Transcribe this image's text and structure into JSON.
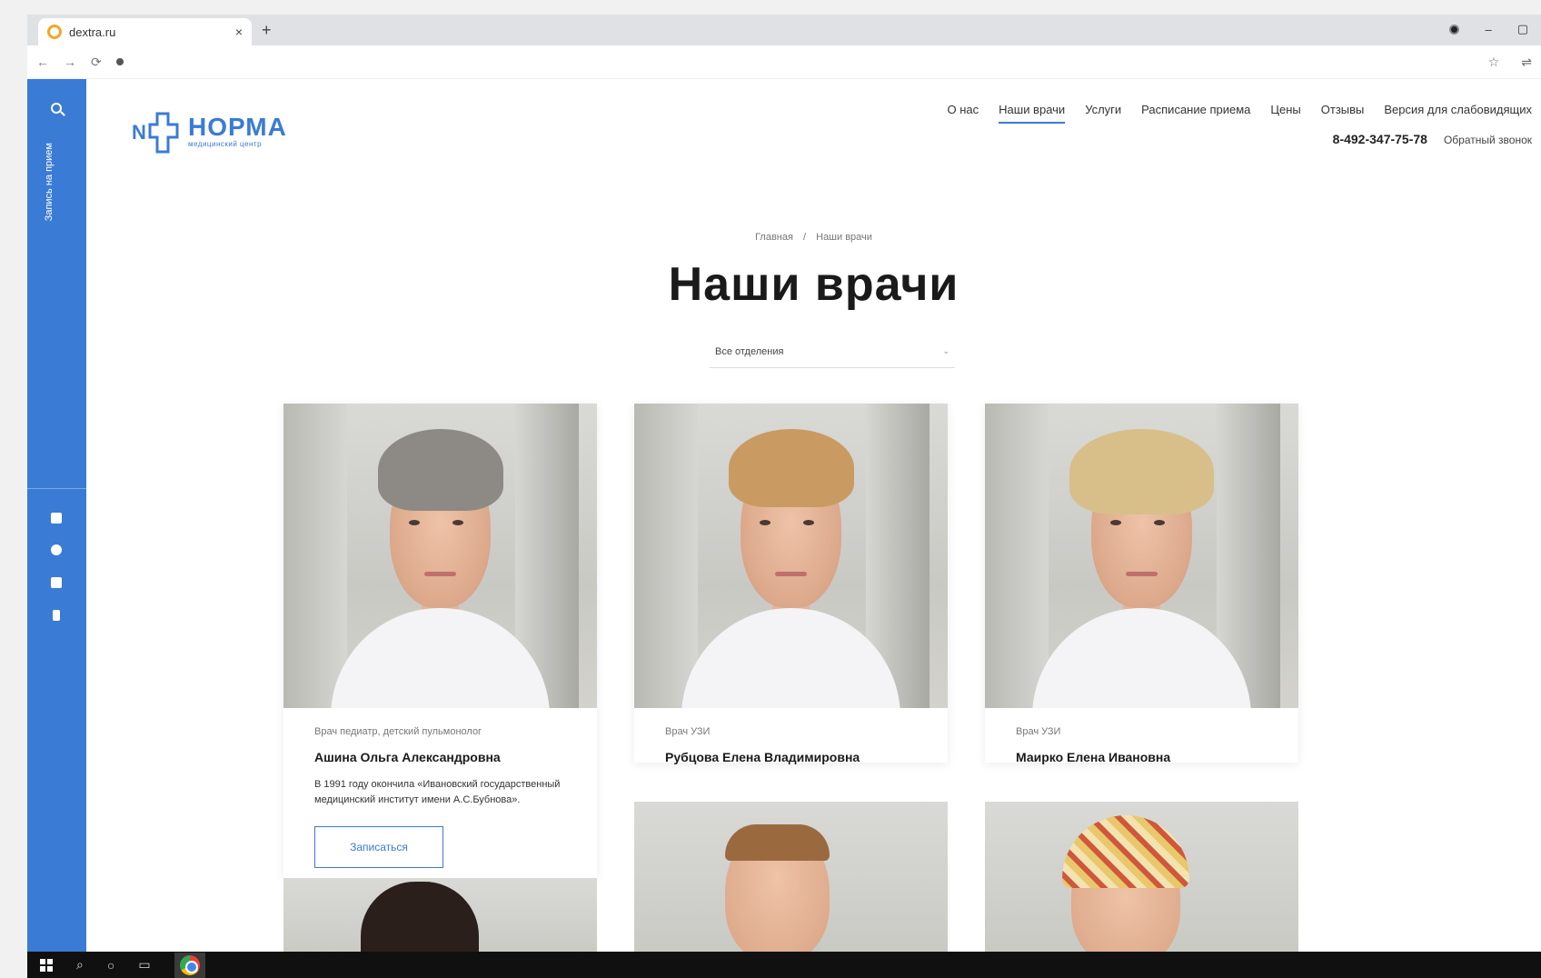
{
  "browser": {
    "tab_title": "dextra.ru",
    "tab_close": "×",
    "new_tab": "+",
    "back": "←",
    "forward": "→",
    "reload": "⟳",
    "url": "",
    "star": "☆",
    "minimize": "–",
    "maximize": "▢"
  },
  "sidebar": {
    "vertical_label": "Запись на прием"
  },
  "logo": {
    "letter": "N",
    "name": "НОРМА",
    "subtitle": "медицинский центр"
  },
  "nav": {
    "items": [
      "О нас",
      "Наши врачи",
      "Услуги",
      "Расписание приема",
      "Цены",
      "Отзывы",
      "Версия для слабовидящих"
    ],
    "active_index": 1
  },
  "contact": {
    "phone": "8-492-347-75-78",
    "callback": "Обратный звонок"
  },
  "breadcrumb": {
    "home": "Главная",
    "separator": "/",
    "current": "Наши врачи"
  },
  "page_title": "Наши врачи",
  "filter": {
    "value": "Все отделения",
    "chevron": "⌄"
  },
  "doctors": [
    {
      "specialty": "Врач педиатр, детский пульмонолог",
      "name": "Ашина Ольга Александровна",
      "bio": "В 1991 году окончила «Ивановский государственный медицинский институт имени А.С.Бубнова».",
      "button": "Записаться",
      "hair_color": "#8d8a86"
    },
    {
      "specialty": "Врач УЗИ",
      "name": "Рубцова Елена Владимировна",
      "hair_color": "#c99a62"
    },
    {
      "specialty": "Врач УЗИ",
      "name": "Маирко Елена Ивановна",
      "hair_color": "#d8bf8a"
    }
  ],
  "colors": {
    "brand_blue": "#3a7bd5"
  }
}
